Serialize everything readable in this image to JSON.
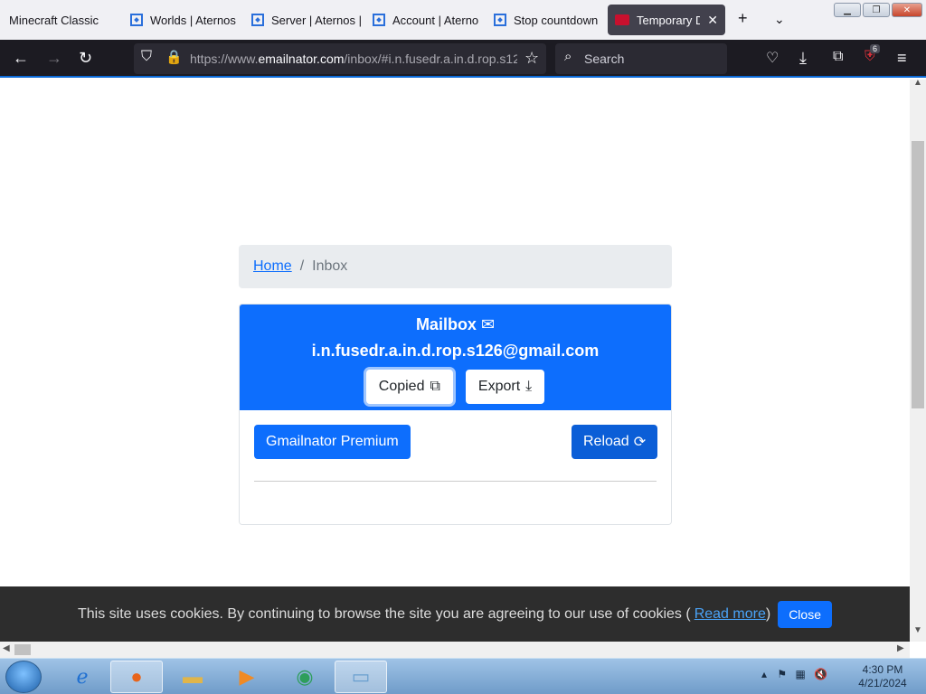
{
  "browser": {
    "tabs": [
      {
        "label": "Minecraft Classic"
      },
      {
        "label": "Worlds | Aternos"
      },
      {
        "label": "Server | Aternos |"
      },
      {
        "label": "Account | Aterno"
      },
      {
        "label": "Stop countdown"
      },
      {
        "label": "Temporary Dis"
      }
    ],
    "url_prefix": "https://www.",
    "url_domain": "emailnator.com",
    "url_rest": "/inbox/#i.n.fusedr.a.in.d.rop.s12",
    "search_placeholder": "Search",
    "extension_badge": "6"
  },
  "page": {
    "breadcrumb": {
      "home": "Home",
      "separator": "/",
      "current": "Inbox"
    },
    "mailbox": {
      "title": "Mailbox",
      "address": "i.n.fusedr.a.in.d.rop.s126@gmail.com",
      "copy_label": "Copied",
      "export_label": "Export"
    },
    "premium_label": "Gmailnator Premium",
    "reload_label": "Reload"
  },
  "cookie": {
    "text": "This site uses cookies. By continuing to browse the site you are agreeing to our use of cookies (",
    "link": "Read more",
    "after": ")",
    "button": "Close"
  },
  "taskbar": {
    "time": "4:30 PM",
    "date": "4/21/2024"
  },
  "colors": {
    "primary": "#0d6efd",
    "browser_chrome": "#1c1b22",
    "cookie_bg": "#2d2d2d"
  }
}
